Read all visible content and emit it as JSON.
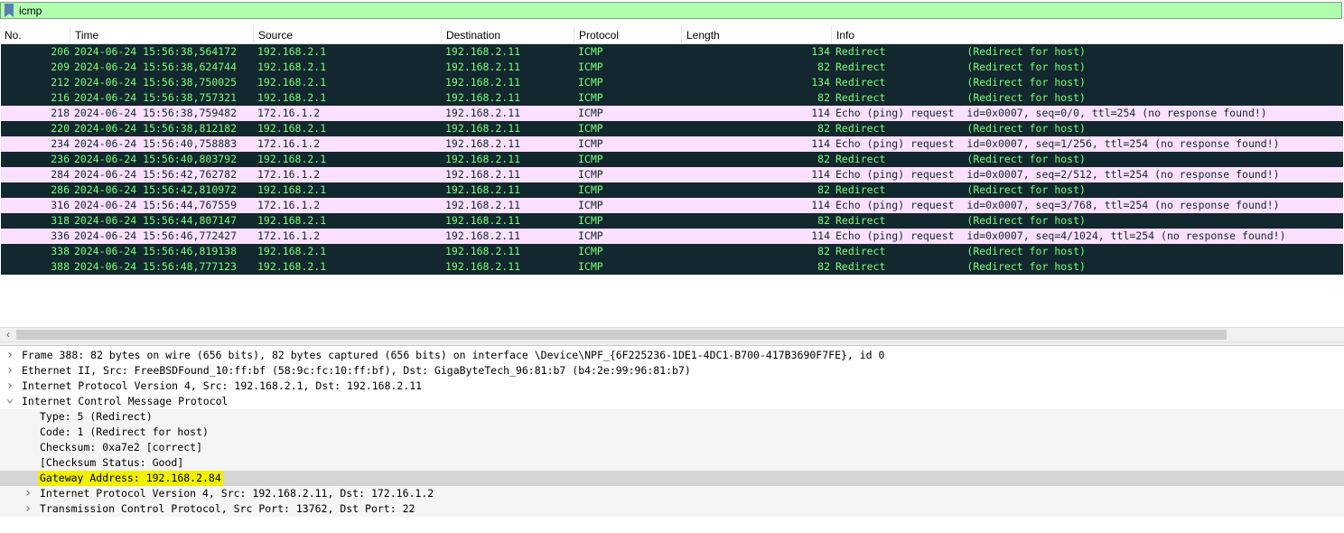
{
  "filter": {
    "value": "icmp"
  },
  "columns": [
    "No.",
    "Time",
    "Source",
    "Destination",
    "Protocol",
    "Length",
    "Info"
  ],
  "packets": [
    {
      "no": "206",
      "time": "2024-06-24 15:56:38,564172",
      "src": "192.168.2.1",
      "dst": "192.168.2.11",
      "proto": "ICMP",
      "len": "134",
      "info": "Redirect             (Redirect for host)",
      "type": "redirect"
    },
    {
      "no": "209",
      "time": "2024-06-24 15:56:38,624744",
      "src": "192.168.2.1",
      "dst": "192.168.2.11",
      "proto": "ICMP",
      "len": "82",
      "info": "Redirect             (Redirect for host)",
      "type": "redirect"
    },
    {
      "no": "212",
      "time": "2024-06-24 15:56:38,750025",
      "src": "192.168.2.1",
      "dst": "192.168.2.11",
      "proto": "ICMP",
      "len": "134",
      "info": "Redirect             (Redirect for host)",
      "type": "redirect"
    },
    {
      "no": "216",
      "time": "2024-06-24 15:56:38,757321",
      "src": "192.168.2.1",
      "dst": "192.168.2.11",
      "proto": "ICMP",
      "len": "82",
      "info": "Redirect             (Redirect for host)",
      "type": "redirect"
    },
    {
      "no": "218",
      "time": "2024-06-24 15:56:38,759482",
      "src": "172.16.1.2",
      "dst": "192.168.2.11",
      "proto": "ICMP",
      "len": "114",
      "info": "Echo (ping) request  id=0x0007, seq=0/0, ttl=254 (no response found!)",
      "type": "echo"
    },
    {
      "no": "220",
      "time": "2024-06-24 15:56:38,812182",
      "src": "192.168.2.1",
      "dst": "192.168.2.11",
      "proto": "ICMP",
      "len": "82",
      "info": "Redirect             (Redirect for host)",
      "type": "redirect"
    },
    {
      "no": "234",
      "time": "2024-06-24 15:56:40,758883",
      "src": "172.16.1.2",
      "dst": "192.168.2.11",
      "proto": "ICMP",
      "len": "114",
      "info": "Echo (ping) request  id=0x0007, seq=1/256, ttl=254 (no response found!)",
      "type": "echo"
    },
    {
      "no": "236",
      "time": "2024-06-24 15:56:40,803792",
      "src": "192.168.2.1",
      "dst": "192.168.2.11",
      "proto": "ICMP",
      "len": "82",
      "info": "Redirect             (Redirect for host)",
      "type": "redirect"
    },
    {
      "no": "284",
      "time": "2024-06-24 15:56:42,762782",
      "src": "172.16.1.2",
      "dst": "192.168.2.11",
      "proto": "ICMP",
      "len": "114",
      "info": "Echo (ping) request  id=0x0007, seq=2/512, ttl=254 (no response found!)",
      "type": "echo"
    },
    {
      "no": "286",
      "time": "2024-06-24 15:56:42,810972",
      "src": "192.168.2.1",
      "dst": "192.168.2.11",
      "proto": "ICMP",
      "len": "82",
      "info": "Redirect             (Redirect for host)",
      "type": "redirect"
    },
    {
      "no": "316",
      "time": "2024-06-24 15:56:44,767559",
      "src": "172.16.1.2",
      "dst": "192.168.2.11",
      "proto": "ICMP",
      "len": "114",
      "info": "Echo (ping) request  id=0x0007, seq=3/768, ttl=254 (no response found!)",
      "type": "echo"
    },
    {
      "no": "318",
      "time": "2024-06-24 15:56:44,807147",
      "src": "192.168.2.1",
      "dst": "192.168.2.11",
      "proto": "ICMP",
      "len": "82",
      "info": "Redirect             (Redirect for host)",
      "type": "redirect"
    },
    {
      "no": "336",
      "time": "2024-06-24 15:56:46,772427",
      "src": "172.16.1.2",
      "dst": "192.168.2.11",
      "proto": "ICMP",
      "len": "114",
      "info": "Echo (ping) request  id=0x0007, seq=4/1024, ttl=254 (no response found!)",
      "type": "echo"
    },
    {
      "no": "338",
      "time": "2024-06-24 15:56:46,819138",
      "src": "192.168.2.1",
      "dst": "192.168.2.11",
      "proto": "ICMP",
      "len": "82",
      "info": "Redirect             (Redirect for host)",
      "type": "redirect"
    },
    {
      "no": "388",
      "time": "2024-06-24 15:56:48,777123",
      "src": "192.168.2.1",
      "dst": "192.168.2.11",
      "proto": "ICMP",
      "len": "82",
      "info": "Redirect             (Redirect for host)",
      "type": "redirect"
    }
  ],
  "details": [
    {
      "text": "Frame 388: 82 bytes on wire (656 bits), 82 bytes captured (656 bits) on interface \\Device\\NPF_{6F225236-1DE1-4DC1-B700-417B3690F7FE}, id 0",
      "level": 0,
      "arrow": "collapsed"
    },
    {
      "text": "Ethernet II, Src: FreeBSDFound_10:ff:bf (58:9c:fc:10:ff:bf), Dst: GigaByteTech_96:81:b7 (b4:2e:99:96:81:b7)",
      "level": 0,
      "arrow": "collapsed"
    },
    {
      "text": "Internet Protocol Version 4, Src: 192.168.2.1, Dst: 192.168.2.11",
      "level": 0,
      "arrow": "collapsed"
    },
    {
      "text": "Internet Control Message Protocol",
      "level": 0,
      "arrow": "expanded"
    },
    {
      "text": "Type: 5 (Redirect)",
      "level": 1,
      "arrow": "none"
    },
    {
      "text": "Code: 1 (Redirect for host)",
      "level": 1,
      "arrow": "none"
    },
    {
      "text": "Checksum: 0xa7e2 [correct]",
      "level": 1,
      "arrow": "none"
    },
    {
      "text": "[Checksum Status: Good]",
      "level": 1,
      "arrow": "none"
    },
    {
      "text": "Gateway Address: 192.168.2.84",
      "level": 1,
      "arrow": "none",
      "selected": true
    },
    {
      "text": "Internet Protocol Version 4, Src: 192.168.2.11, Dst: 172.16.1.2",
      "level": 1,
      "arrow": "collapsed"
    },
    {
      "text": "Transmission Control Protocol, Src Port: 13762, Dst Port: 22",
      "level": 1,
      "arrow": "collapsed"
    }
  ],
  "colors": {
    "redirect_bg": "#12272e",
    "redirect_fg": "#78ff78",
    "echo_bg": "#fce0ff",
    "echo_fg": "#12272e",
    "filter_bg": "#afffaf",
    "highlight": "#f0f000"
  },
  "icons": {
    "filter_bookmark": "bookmark-icon",
    "scroll_left": "chevron-left-icon",
    "tree_collapsed": "chevron-right-icon",
    "tree_expanded": "chevron-down-icon"
  }
}
